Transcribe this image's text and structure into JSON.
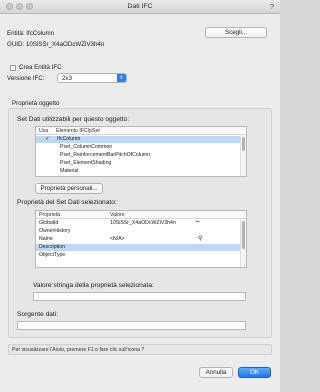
{
  "window": {
    "title": "Dati IFC",
    "help": "?"
  },
  "entity": {
    "label": "Entità: IfcColumn",
    "guid": "GUID: 10SiSSr_X4aODcWZiV3h4n",
    "choose_button": "Scegli..."
  },
  "create_ifc": {
    "label": "Crea Entità IFC",
    "checked": false
  },
  "version": {
    "label": "Versione IFC:",
    "value": "2x3"
  },
  "properties": {
    "section_label": "Proprietà oggetto",
    "sets_label": "Set Dati utilizzabili per questo oggetto:",
    "sets_columns": [
      "Usa",
      "Elemento IFC/pSet"
    ],
    "sets_rows": [
      {
        "use": "",
        "name": "IfcColumn",
        "selected": true,
        "checked": true
      },
      {
        "use": "",
        "name": "Pset_ColumnCommon",
        "selected": false,
        "checked": false
      },
      {
        "use": "",
        "name": "Pset_ReinforcementBarPitchOfColumn",
        "selected": false,
        "checked": false
      },
      {
        "use": "",
        "name": "Pset_ElementShading",
        "selected": false,
        "checked": false
      },
      {
        "use": "",
        "name": "Material",
        "selected": false,
        "checked": false
      }
    ],
    "custom_button": "Proprietà personali...",
    "selected_set_label": "Proprietà del Set Dati selezionato:",
    "prop_columns": [
      "Proprietà",
      "Valore"
    ],
    "prop_rows": [
      {
        "name": "GlobalId",
        "value": "10SiSSr_X4aODcWZiV3h4n",
        "selected": false
      },
      {
        "name": "OwnerHistory",
        "value": "",
        "selected": false
      },
      {
        "name": "Name",
        "value": "<N/A>",
        "selected": false
      },
      {
        "name": "Description",
        "value": "",
        "selected": true
      },
      {
        "name": "ObjectType",
        "value": "",
        "selected": false
      }
    ]
  },
  "value_string": {
    "label": "Valore stringa della proprietà selezionata:",
    "value": ""
  },
  "data_source": {
    "label": "Sorgente dati:",
    "value": ""
  },
  "status": "Per visualizzare l'Aiuto, premere F1 o fare clic sull'icona ?",
  "buttons": {
    "cancel": "Annulla",
    "ok": "OK"
  }
}
